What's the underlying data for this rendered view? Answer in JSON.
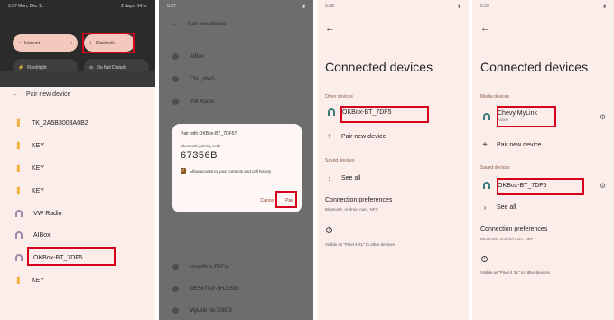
{
  "panel1": {
    "status_left": "5:57 Mon, Dec 11",
    "status_right": "2 days, 14 hr",
    "tiles": {
      "internet": "Internet",
      "bluetooth": "Bluetooth",
      "flashlight": "Flashlight",
      "dnd": "Do Not Disturb"
    },
    "header": "Pair new device",
    "devices": [
      {
        "name": "TK_2A5B3003A0B2",
        "icon": "bluetooth-icon"
      },
      {
        "name": "KEY",
        "icon": "bluetooth-icon"
      },
      {
        "name": "KEY",
        "icon": "bluetooth-icon"
      },
      {
        "name": "KEY",
        "icon": "bluetooth-icon"
      },
      {
        "name": "VW Radio",
        "icon": "headphones-icon"
      },
      {
        "name": "AIBox",
        "icon": "headphones-icon"
      },
      {
        "name": "OKBox-BT_7DF5",
        "icon": "headphones-icon"
      },
      {
        "name": "KEY",
        "icon": "bluetooth-icon"
      }
    ]
  },
  "panel2": {
    "status_left": "5:57",
    "title": "Pair new device",
    "rows_top": [
      "AIBox",
      "TSL_d6a5",
      "VW Radio"
    ],
    "rows_bottom": [
      "smartBox-FFCa",
      "DESKTOP-5HJ2539",
      "MyLink No 30833"
    ],
    "dialog": {
      "title": "Pair with OKBox-BT_7DF5?",
      "code_label": "Bluetooth pairing code",
      "code": "67356B",
      "checkbox_label": "Allow access to your contacts and call history",
      "cancel": "Cancel",
      "pair": "Pair"
    }
  },
  "panel3": {
    "status_left": "5:58",
    "title": "Connected devices",
    "other_section": "Other devices",
    "device": "OKBox-BT_7DF5",
    "pair_new": "Pair new device",
    "saved_section": "Saved devices",
    "see_all": "See all",
    "pref_title": "Connection preferences",
    "pref_sub": "Bluetooth, Android Auto, NFC",
    "visible": "Visible as \"Pixel 4 XL\" to other devices"
  },
  "panel4": {
    "status_left": "5:59",
    "title": "Connected devices",
    "media_section": "Media devices",
    "media_device": "Chevy MyLink",
    "media_sub": "Active",
    "pair_new": "Pair new device",
    "saved_section": "Saved devices",
    "saved_device": "OKBox-BT_7DF5",
    "see_all": "See all",
    "pref_title": "Connection preferences",
    "pref_sub": "Bluetooth, Android Auto, NFC",
    "visible": "Visible as \"Pixel 4 XL\" to other devices"
  },
  "colors": {
    "highlight": "#d6001c",
    "background": "#fbeeea",
    "tile_active": "#f3c8bd"
  }
}
